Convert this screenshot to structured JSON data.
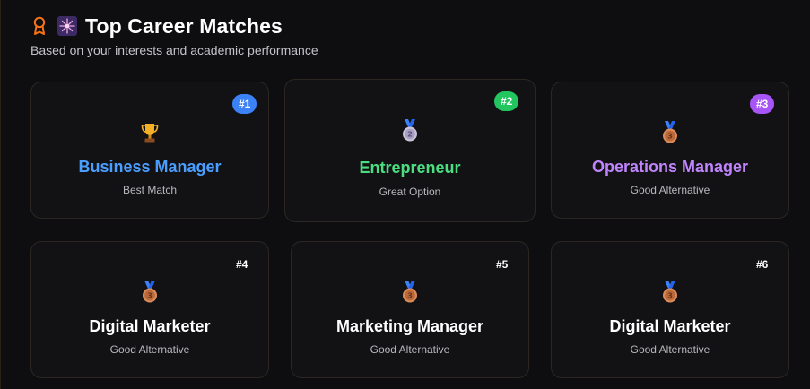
{
  "header": {
    "title": "Top Career Matches",
    "subtitle": "Based on your interests and academic performance",
    "icons": [
      "ribbon-award-icon",
      "firework-icon"
    ]
  },
  "cards": [
    {
      "rank": "#1",
      "name": "Business Manager",
      "desc": "Best Match",
      "icon": "trophy-icon",
      "accent": "#4a9eff",
      "badge_color": "#3b82f6"
    },
    {
      "rank": "#2",
      "name": "Entrepreneur",
      "desc": "Great Option",
      "icon": "silver-medal-icon",
      "accent": "#4ade80",
      "badge_color": "#22c55e"
    },
    {
      "rank": "#3",
      "name": "Operations Manager",
      "desc": "Good Alternative",
      "icon": "bronze-medal-icon",
      "accent": "#c084fc",
      "badge_color": "#a855f7"
    },
    {
      "rank": "#4",
      "name": "Digital Marketer",
      "desc": "Good Alternative",
      "icon": "bronze-medal-icon",
      "accent": "#ffffff"
    },
    {
      "rank": "#5",
      "name": "Marketing Manager",
      "desc": "Good Alternative",
      "icon": "bronze-medal-icon",
      "accent": "#ffffff"
    },
    {
      "rank": "#6",
      "name": "Digital Marketer",
      "desc": "Good Alternative",
      "icon": "bronze-medal-icon",
      "accent": "#ffffff"
    }
  ]
}
